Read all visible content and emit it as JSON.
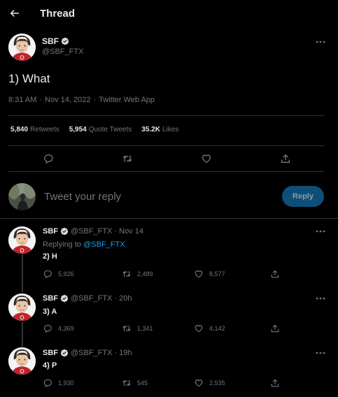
{
  "header": {
    "title": "Thread"
  },
  "main_tweet": {
    "name": "SBF",
    "handle": "@SBF_FTX",
    "text": "1) What",
    "time": "8:31 AM",
    "sep1": "·",
    "date": "Nov 14, 2022",
    "sep2": "·",
    "source": "Twitter Web App",
    "stats": {
      "retweets_value": "5,840",
      "retweets_label": "Retweets",
      "quotes_value": "5,954",
      "quotes_label": "Quote Tweets",
      "likes_value": "35.2K",
      "likes_label": "Likes"
    }
  },
  "reply_box": {
    "placeholder": "Tweet your reply",
    "button_label": "Reply"
  },
  "replies": [
    {
      "name": "SBF",
      "handle": "@SBF_FTX",
      "sep": "·",
      "time": "Nov 14",
      "replying_prefix": "Replying to",
      "replying_to": "@SBF_FTX",
      "text": "2) H",
      "replies": "5,926",
      "retweets": "2,489",
      "likes": "8,577"
    },
    {
      "name": "SBF",
      "handle": "@SBF_FTX",
      "sep": "·",
      "time": "20h",
      "text": "3) A",
      "replies": "4,369",
      "retweets": "1,341",
      "likes": "4,142"
    },
    {
      "name": "SBF",
      "handle": "@SBF_FTX",
      "sep": "·",
      "time": "19h",
      "text": "4) P",
      "replies": "1,930",
      "retweets": "545",
      "likes": "2,535"
    }
  ],
  "colors": {
    "background": "#000000",
    "text": "#e7e9ea",
    "muted": "#71767b",
    "accent": "#1d9bf0",
    "reply_button": "#0f4e78"
  },
  "icons": [
    "back-arrow-icon",
    "verified-badge-icon",
    "more-icon",
    "reply-icon",
    "retweet-icon",
    "like-icon",
    "share-icon"
  ]
}
